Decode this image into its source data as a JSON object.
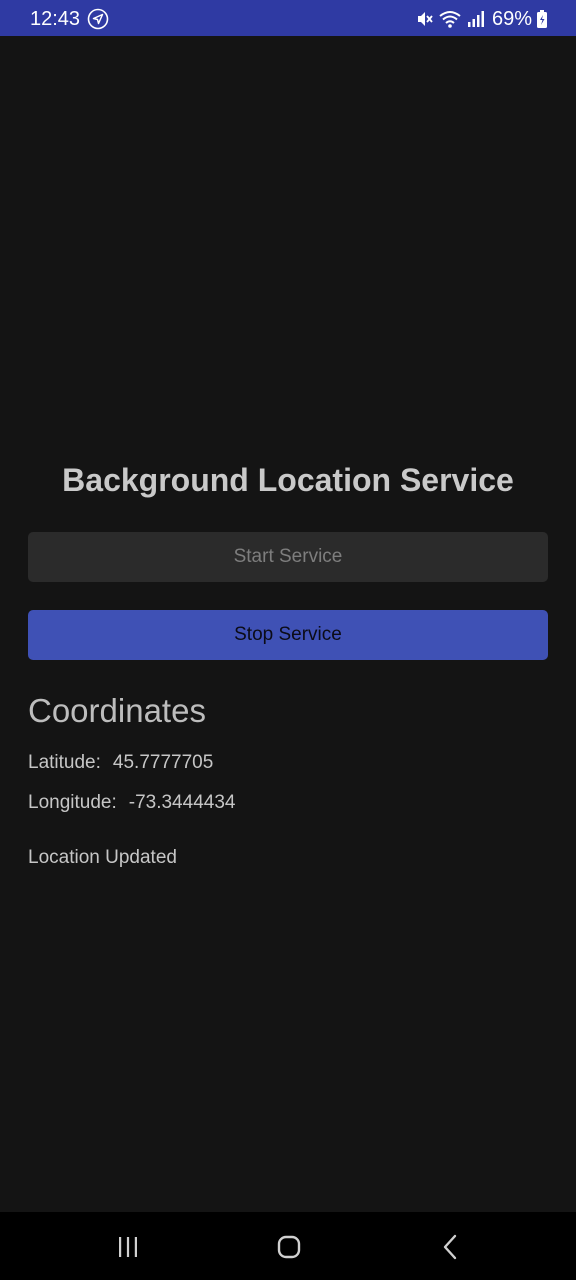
{
  "status_bar": {
    "time": "12:43",
    "battery": "69%",
    "icons": [
      "navigation-arrow-icon",
      "mute-icon",
      "wifi-icon",
      "signal-icon",
      "battery-icon"
    ]
  },
  "app": {
    "title": "Background Location Service",
    "start_button_label": "Start Service",
    "stop_button_label": "Stop Service",
    "coordinates_heading": "Coordinates",
    "latitude_label": "Latitude:",
    "latitude_value": "45.7777705",
    "longitude_label": "Longitude:",
    "longitude_value": "-73.3444434",
    "status_text": "Location Updated"
  },
  "nav_bar": {
    "icons": [
      "recents-icon",
      "home-icon",
      "back-icon"
    ]
  },
  "colors": {
    "status_bar": "#2f3aa3",
    "background": "#141414",
    "start_button": "#2b2b2b",
    "stop_button": "#3f51b5",
    "nav_bar": "#000000"
  }
}
